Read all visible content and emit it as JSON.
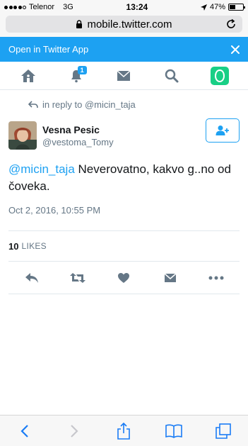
{
  "status_bar": {
    "carrier": "Telenor",
    "network": "3G",
    "time": "13:24",
    "battery": "47%",
    "battery_level": 0.47
  },
  "browser": {
    "url": "mobile.twitter.com"
  },
  "banner": {
    "label": "Open in Twitter App",
    "close_icon": "close-icon"
  },
  "nav": {
    "items": [
      "home-icon",
      "notifications-icon",
      "messages-icon",
      "search-icon",
      "compose-icon"
    ],
    "notifications_badge": "1"
  },
  "tweet": {
    "reply_to_text": "in reply to @micin_taja",
    "author_name": "Vesna Pesic",
    "author_handle": "@vestoma_Tomy",
    "mention": "@micin_taja",
    "body": " Neverovatno, kakvo g..no od čoveka.",
    "date": "Oct 2, 2016, 10:55 PM",
    "likes_count": "10",
    "likes_label": "LIKES"
  },
  "actions": [
    "reply-icon",
    "retweet-icon",
    "like-icon",
    "direct-message-icon",
    "more-icon"
  ],
  "colors": {
    "brand": "#1da1f2",
    "compose": "#19cf86",
    "muted": "#657786",
    "icon": "#657786"
  },
  "safari_toolbar": [
    "back-icon",
    "forward-icon",
    "share-icon",
    "bookmarks-icon",
    "tabs-icon"
  ]
}
